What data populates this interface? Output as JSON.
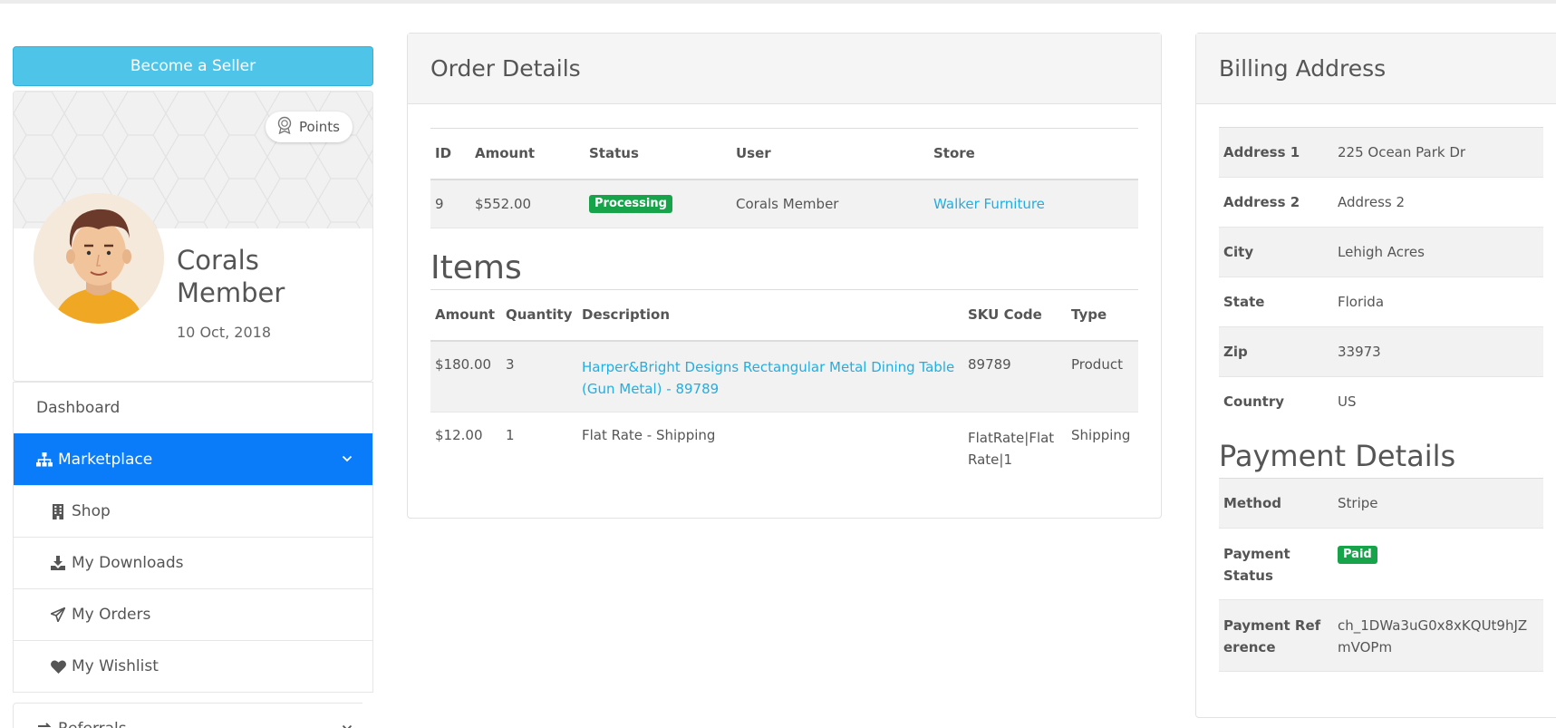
{
  "sidebar": {
    "seller_button": "Become a Seller",
    "points_label": "Points",
    "profile_name": "Corals Member",
    "profile_date": "10 Oct, 2018",
    "menu": [
      {
        "label": "Dashboard",
        "icon": "none"
      },
      {
        "label": "Marketplace",
        "icon": "sitemap-icon"
      },
      {
        "label": "Shop",
        "icon": "building-icon"
      },
      {
        "label": "My Downloads",
        "icon": "download-icon"
      },
      {
        "label": "My Orders",
        "icon": "paper-plane-icon"
      },
      {
        "label": "My Wishlist",
        "icon": "heart-icon"
      },
      {
        "label": "Referrals",
        "icon": "exchange-icon"
      }
    ],
    "active_color": "#0a7cf9"
  },
  "order": {
    "title": "Order Details",
    "columns": [
      "ID",
      "Amount",
      "Status",
      "User",
      "Store"
    ],
    "row": {
      "id": "9",
      "amount": "$552.00",
      "status": "Processing",
      "user": "Corals Member",
      "store": "Walker Furniture"
    },
    "items_title": "Items",
    "item_columns": [
      "Amount",
      "Quantity",
      "Description",
      "SKU Code",
      "Type"
    ],
    "items": [
      {
        "amount": "$180.00",
        "quantity": "3",
        "description": "Harper&Bright Designs Rectangular Metal Dining Table (Gun Metal) - 89789",
        "sku": "89789",
        "type": "Product"
      },
      {
        "amount": "$12.00",
        "quantity": "1",
        "description": "Flat Rate - Shipping",
        "sku": "FlatRate|Flat Rate|1",
        "type": "Shipping"
      }
    ]
  },
  "billing": {
    "title": "Billing Address",
    "rows": [
      {
        "label": "Address 1",
        "value": "225 Ocean Park Dr"
      },
      {
        "label": "Address 2",
        "value": "Address 2"
      },
      {
        "label": "City",
        "value": "Lehigh Acres"
      },
      {
        "label": "State",
        "value": "Florida"
      },
      {
        "label": "Zip",
        "value": "33973"
      },
      {
        "label": "Country",
        "value": "US"
      }
    ],
    "payment_title": "Payment Details",
    "payment": {
      "method_label": "Method",
      "method": "Stripe",
      "status_label": "Payment Status",
      "status": "Paid",
      "reference_label": "Payment Reference",
      "reference": "ch_1DWa3uG0x8xKQUt9hJZmVOPm"
    }
  },
  "colors": {
    "accent": "#4dc4e8",
    "link": "#22aee0",
    "success": "#16a34a"
  }
}
